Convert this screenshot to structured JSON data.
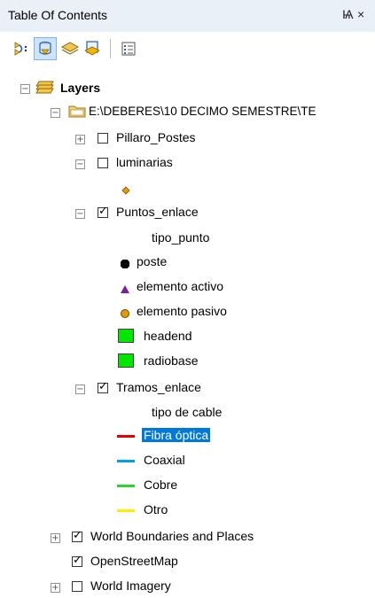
{
  "window": {
    "title": "Table Of Contents",
    "pin_glyph": "Ѩ",
    "close_glyph": "×"
  },
  "toolbar": {
    "buttons": [
      "list-by-drawing-order",
      "list-by-source",
      "list-by-visibility",
      "list-by-selection",
      "options"
    ]
  },
  "tree": {
    "root_label": "Layers",
    "folder_label": "E:\\DEBERES\\10 DECIMO SEMESTRE\\TE",
    "layers": {
      "pillaro": {
        "label": "Pillaro_Postes",
        "checked": false
      },
      "luminarias": {
        "label": "luminarias",
        "checked": false
      },
      "puntos": {
        "label": "Puntos_enlace",
        "checked": true,
        "field": "tipo_punto",
        "classes": [
          "poste",
          "elemento activo",
          "elemento pasivo",
          "headend",
          "radiobase"
        ]
      },
      "tramos": {
        "label": "Tramos_enlace",
        "checked": true,
        "field": "tipo de cable",
        "classes": [
          "Fibra óptica",
          "Coaxial",
          "Cobre",
          "Otro"
        ]
      },
      "world_boundaries": {
        "label": "World Boundaries and Places",
        "checked": true
      },
      "osm": {
        "label": "OpenStreetMap",
        "checked": true
      },
      "world_imagery": {
        "label": "World Imagery",
        "checked": false
      }
    }
  },
  "colors": {
    "selection": "#0078d7",
    "fibra": "#e60000",
    "coaxial": "#00a0e6",
    "cobre": "#2ed12e",
    "otro": "#ffee00",
    "headend": "#00e600",
    "activo": "#7a1fa2",
    "pasivo": "#e69a00"
  }
}
